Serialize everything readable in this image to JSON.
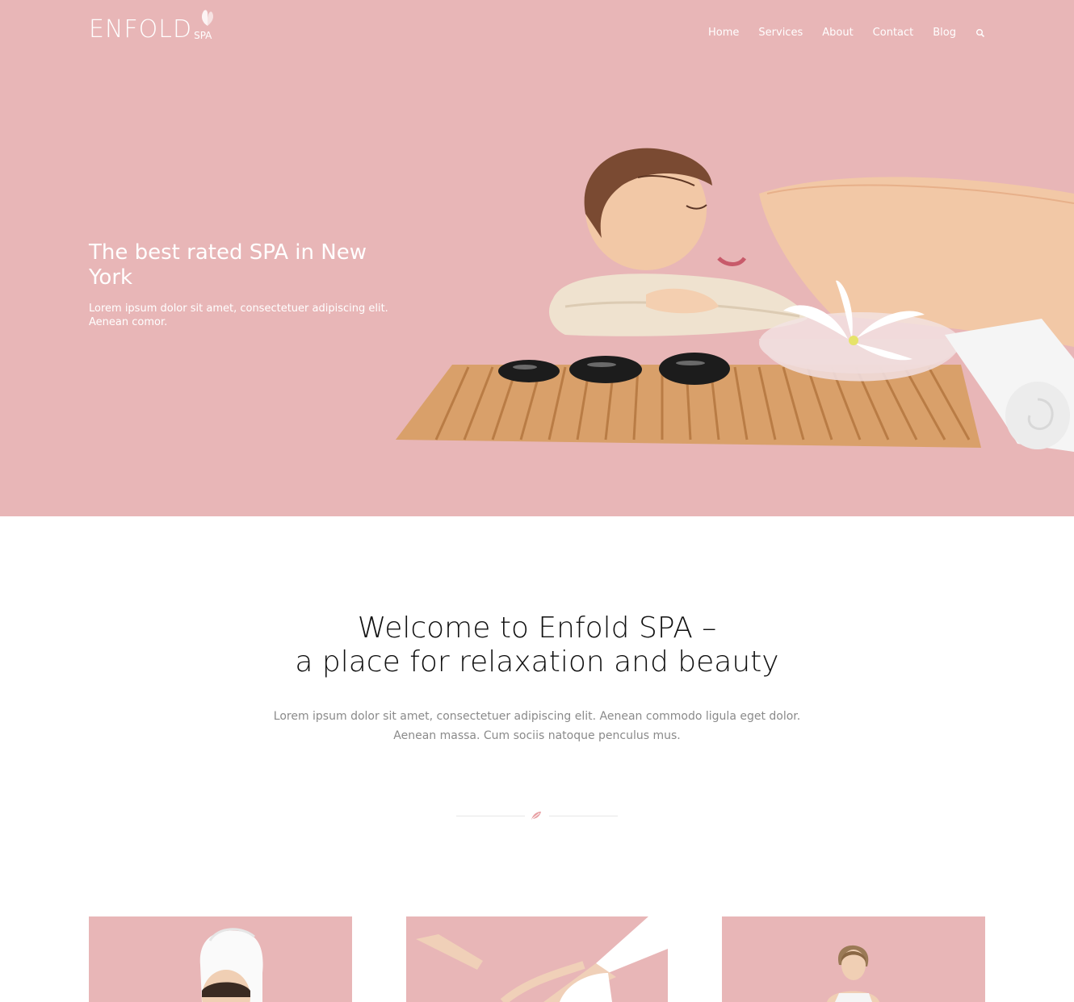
{
  "brand": {
    "logo_main": "ENFOLD",
    "logo_sub": "SPA",
    "logo_icon": "butterfly-icon"
  },
  "nav": {
    "items": [
      {
        "label": "Home"
      },
      {
        "label": "Services"
      },
      {
        "label": "About"
      },
      {
        "label": "Contact"
      },
      {
        "label": "Blog"
      }
    ],
    "search_icon": "search-icon"
  },
  "hero": {
    "title": "The best rated SPA in New York",
    "text": "Lorem ipsum dolor sit amet, consectetuer adipiscing elit. Aenean comor.",
    "image": "woman-relaxing-on-towel-with-hot-stones-and-lily"
  },
  "welcome": {
    "title_line1": "Welcome to Enfold SPA –",
    "title_line2": "a place for relaxation and beauty",
    "text_line1": "Lorem ipsum dolor sit amet, consectetuer adipiscing elit. Aenean commodo ligula eget dolor.",
    "text_line2": "Aenean massa. Cum sociis natoque penculus mus.",
    "divider_icon": "leaf-icon"
  },
  "cards": [
    {
      "image": "woman-with-towel-on-head"
    },
    {
      "image": "woman-stretching-legs"
    },
    {
      "image": "woman-meditating"
    }
  ],
  "colors": {
    "hero_bg": "#e8b6b7",
    "accent": "#e8a0a4",
    "text_dark": "#111111",
    "text_muted": "#8a8a8a"
  }
}
